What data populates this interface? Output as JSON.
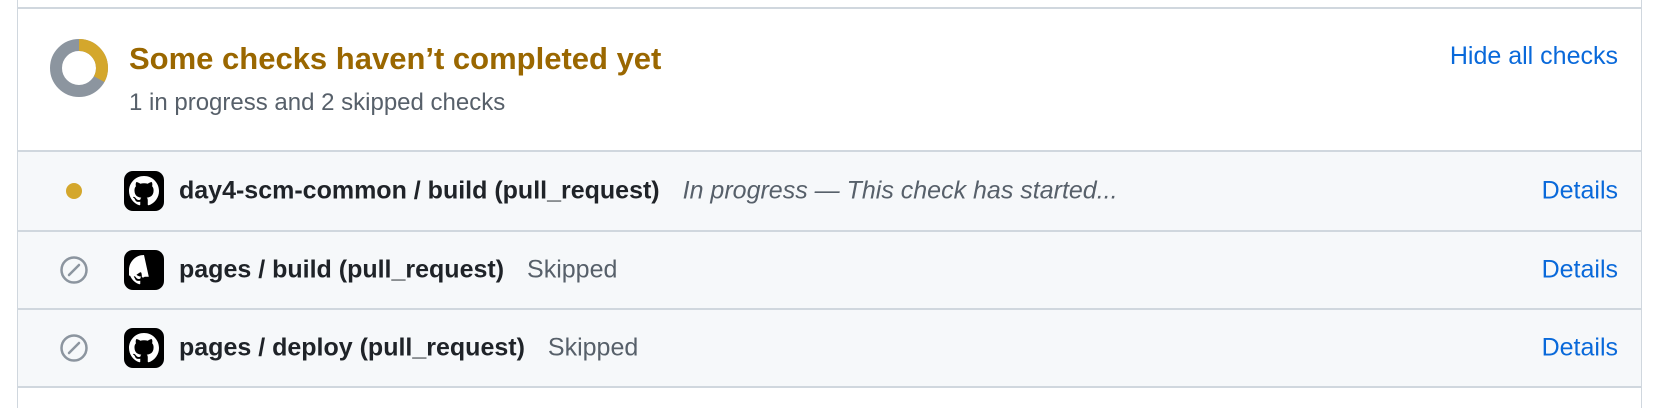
{
  "summary": {
    "title": "Some checks haven’t completed yet",
    "subtitle": "1 in progress and 2 skipped checks",
    "hide_link": "Hide all checks",
    "in_progress_fraction": 0.33
  },
  "checks": [
    {
      "status": "in-progress",
      "name": "day4-scm-common / build (pull_request)",
      "description": "In progress — This check has started...",
      "details_label": "Details"
    },
    {
      "status": "skipped",
      "name": "pages / build (pull_request)",
      "description": "Skipped",
      "details_label": "Details"
    },
    {
      "status": "skipped",
      "name": "pages / deploy (pull_request)",
      "description": "Skipped",
      "details_label": "Details"
    }
  ],
  "colors": {
    "pending": "#d4a72c",
    "skipped": "#8c959f",
    "title": "#9a6700",
    "link": "#0969da"
  },
  "icons": {
    "summary": "status-ring-icon",
    "app": "github-mark-icon",
    "in_progress": "pending-dot-icon",
    "skipped": "skip-circle-slash-icon"
  }
}
